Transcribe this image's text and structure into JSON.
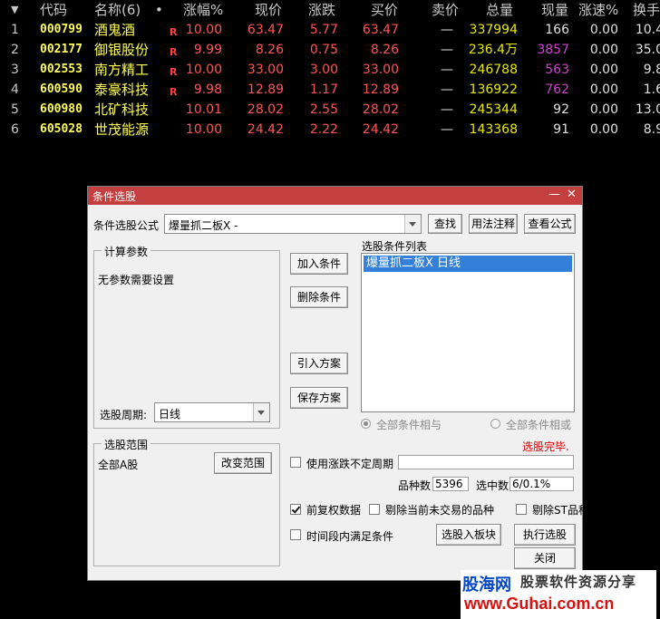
{
  "table": {
    "sort_indicator": "▼",
    "headers": {
      "code": "代码",
      "name": "名称(6)",
      "dot": "•",
      "change_pct": "涨幅%",
      "price": "现价",
      "change": "涨跌",
      "bid": "买价",
      "ask": "卖价",
      "volume": "总量",
      "cur_vol": "现量",
      "speed": "涨速%",
      "turnover": "换手"
    },
    "rows": [
      {
        "idx": "1",
        "code": "000799",
        "name": "酒鬼酒",
        "flag": "R",
        "pct": "10.00",
        "price": "63.47",
        "chg": "5.77",
        "bid": "63.47",
        "ask": "—",
        "vol": "337994",
        "cur": "166",
        "speed": "0.00",
        "turn": "10.4"
      },
      {
        "idx": "2",
        "code": "002177",
        "name": "御银股份",
        "flag": "R",
        "pct": "9.99",
        "price": "8.26",
        "chg": "0.75",
        "bid": "8.26",
        "ask": "—",
        "vol": "236.4万",
        "cur": "3857",
        "speed": "0.00",
        "turn": "35.0"
      },
      {
        "idx": "3",
        "code": "002553",
        "name": "南方精工",
        "flag": "R",
        "pct": "10.00",
        "price": "33.00",
        "chg": "3.00",
        "bid": "33.00",
        "ask": "—",
        "vol": "246788",
        "cur": "563",
        "speed": "0.00",
        "turn": "9.8"
      },
      {
        "idx": "4",
        "code": "600590",
        "name": "泰豪科技",
        "flag": "R",
        "pct": "9.98",
        "price": "12.89",
        "chg": "1.17",
        "bid": "12.89",
        "ask": "—",
        "vol": "136922",
        "cur": "762",
        "speed": "0.00",
        "turn": "1.6"
      },
      {
        "idx": "5",
        "code": "600980",
        "name": "北矿科技",
        "flag": "",
        "pct": "10.01",
        "price": "28.02",
        "chg": "2.55",
        "bid": "28.02",
        "ask": "—",
        "vol": "245344",
        "cur": "92",
        "speed": "0.00",
        "turn": "13.0"
      },
      {
        "idx": "6",
        "code": "605028",
        "name": "世茂能源",
        "flag": "",
        "pct": "10.00",
        "price": "24.42",
        "chg": "2.22",
        "bid": "24.42",
        "ask": "—",
        "vol": "143368",
        "cur": "91",
        "speed": "0.00",
        "turn": "8.9"
      }
    ]
  },
  "dialog": {
    "title": "条件选股",
    "minimize": "—",
    "close": "✕",
    "formula_label": "条件选股公式",
    "formula_value": "爆量抓二板X  -",
    "find_btn": "查找",
    "usage_btn": "用法注释",
    "view_btn": "查看公式",
    "params_group": "计算参数",
    "params_text": "无参数需要设置",
    "period_label": "选股周期:",
    "period_value": "日线",
    "add_btn": "加入条件",
    "delete_btn": "删除条件",
    "import_btn": "引入方案",
    "save_btn": "保存方案",
    "list_title": "选股条件列表",
    "list_item": "爆量抓二板X  日线",
    "radio_and": "全部条件相与",
    "radio_or": "全部条件相或",
    "status": "选股完毕.",
    "range_group": "选股范围",
    "range_value": "全部A股",
    "change_range_btn": "改变范围",
    "indefinite_period": "使用涨跌不定周期",
    "count_label": "品种数",
    "count_value": "5396",
    "selected_label": "选中数",
    "selected_value": "6/0.1%",
    "pre_adjust": "前复权数据",
    "exclude_untraded": "剔除当前未交易的品种",
    "exclude_st": "剔除ST品种",
    "time_range": "时间段内满足条件",
    "to_block_btn": "选股入板块",
    "run_btn": "执行选股",
    "close_btn": "关闭",
    "checks": {
      "indefinite": false,
      "pre_adjust": true,
      "untraded": false,
      "st": false,
      "time_range": false
    }
  },
  "watermark": {
    "brand": "股海网",
    "slogan": "股票软件资源分享",
    "url": "www.Guhai.com.cn"
  },
  "colors": {
    "background": "#000000",
    "title_bar": "#c44040",
    "up_red": "#ff5454",
    "code_yellow": "#ffff54",
    "selection_blue": "#3380d8"
  }
}
